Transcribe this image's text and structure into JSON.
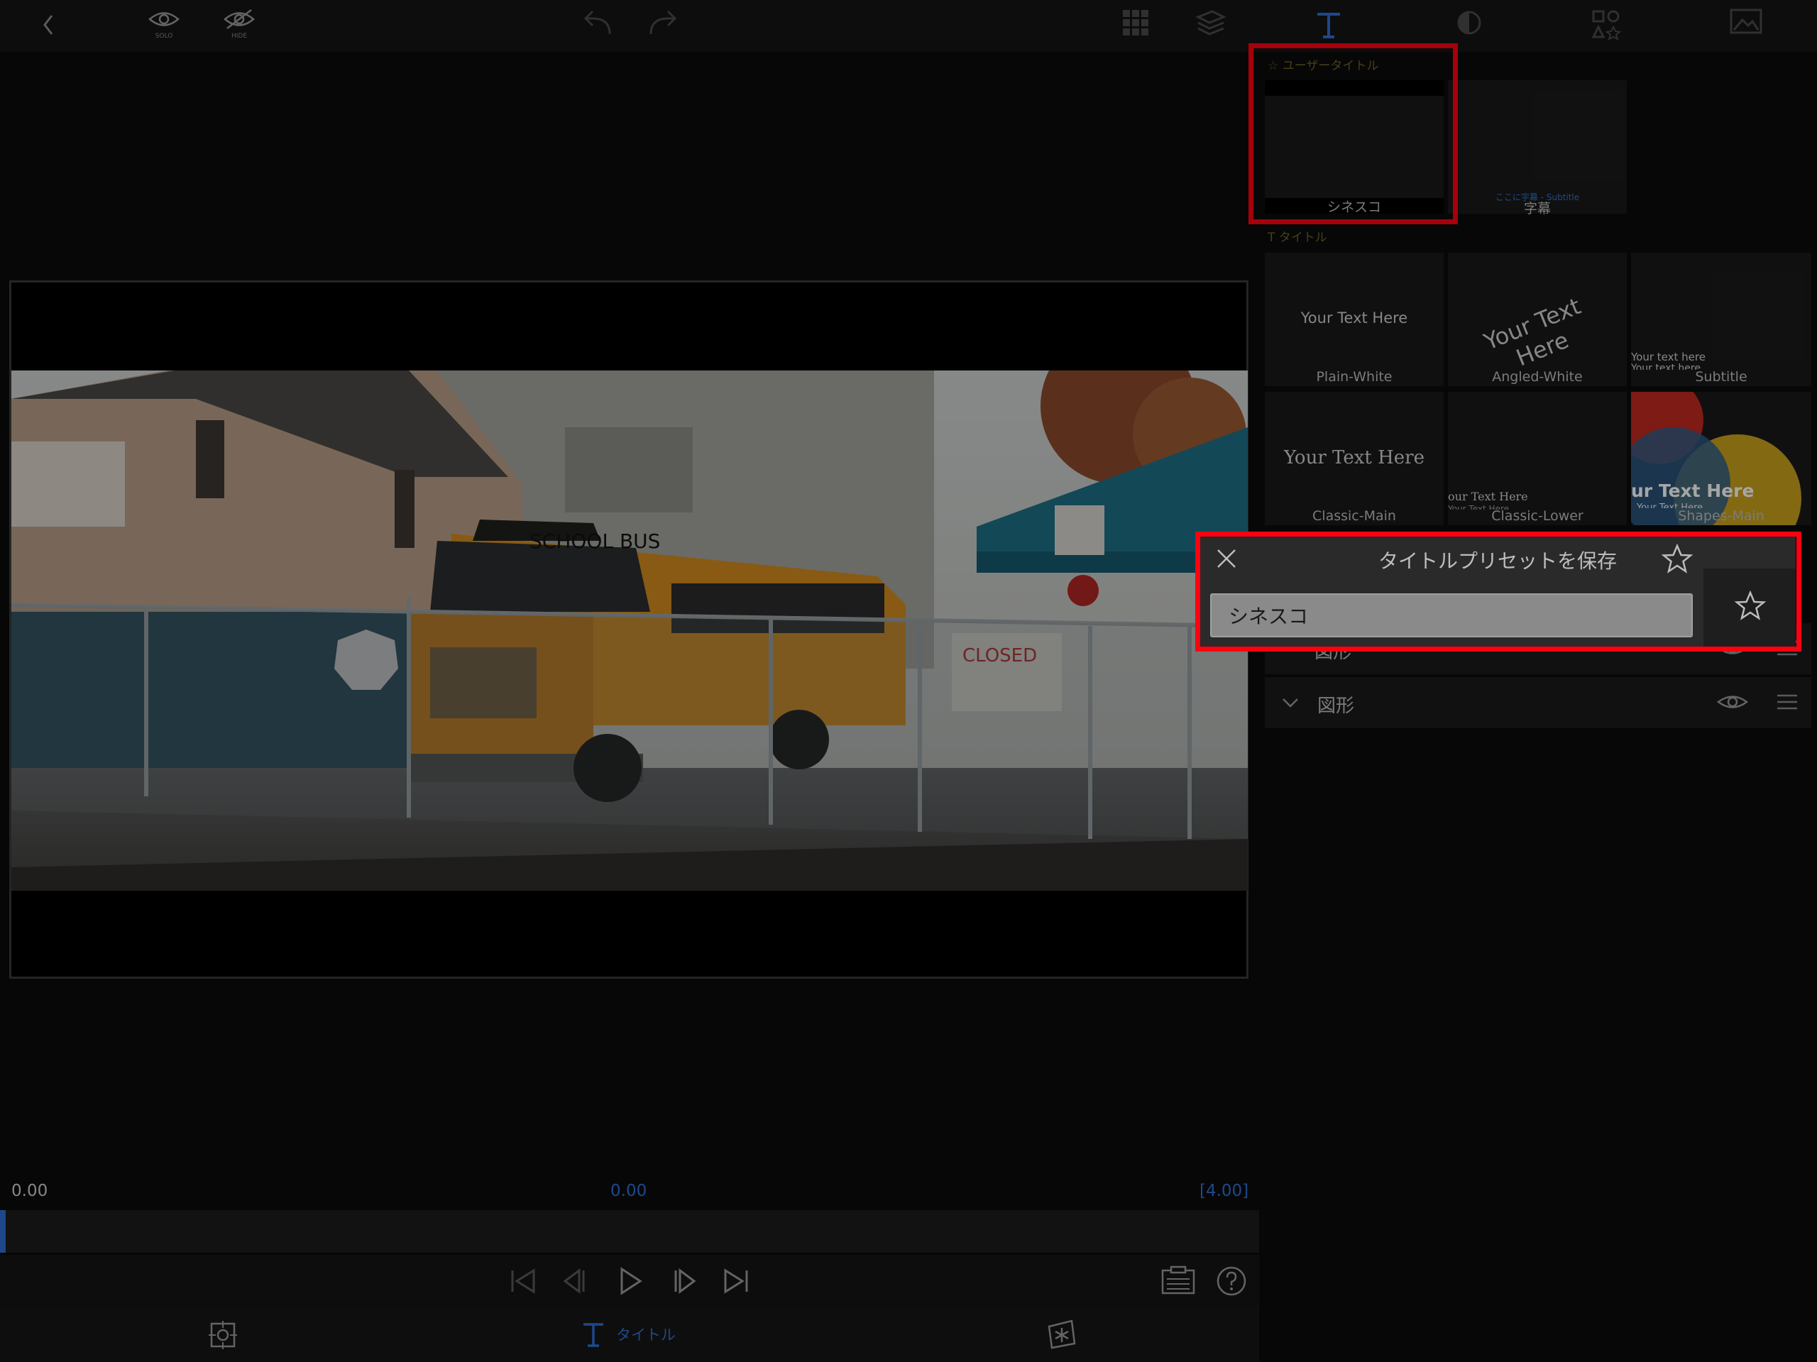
{
  "topbar": {
    "back_icon": "chevron-left-icon",
    "solo_label": "SOLO",
    "hide_label": "HIDE",
    "undo_icon": "undo-icon",
    "redo_icon": "redo-icon",
    "grid_icon": "grid-icon",
    "layers_icon": "layers-icon",
    "title_tool_icon": "title-T-icon",
    "color_icon": "color-circle-icon",
    "shapes_icon": "shapes-icon",
    "image_icon": "image-icon",
    "accent_color": "#2f6fd6"
  },
  "presets": {
    "user_section_label": "ユーザータイトル",
    "user_items": [
      {
        "label": "シネスコ"
      },
      {
        "label": "字幕",
        "preview_text": "ここに字幕 - Subtitle"
      }
    ],
    "title_section_label": "タイトル",
    "title_items": [
      {
        "label": "Plain-White",
        "preview_text": "Your Text Here"
      },
      {
        "label": "Angled-White",
        "preview_text": "Your Text Here"
      },
      {
        "label": "Subtitle",
        "preview_text": "Your text here",
        "preview_text2": "Your text here"
      },
      {
        "label": "Classic-Main",
        "preview_text": "Your Text Here"
      },
      {
        "label": "Classic-Lower",
        "preview_text": "our Text Here",
        "preview_text2": "Your Text Here"
      },
      {
        "label": "Shapes-Main",
        "preview_text": "ur Text Here",
        "preview_text2": "Your Text Here"
      }
    ]
  },
  "dialog": {
    "title": "タイトルプリセットを保存",
    "input_value": "シネスコ",
    "close_icon": "close-x-icon",
    "favorite_icon": "star-outline-icon"
  },
  "layers": [
    {
      "label": "図形",
      "icon": "eye-icon"
    },
    {
      "label": "図形",
      "icon": "eye-icon"
    }
  ],
  "timeline": {
    "start_time": "0.00",
    "current_time": "0.00",
    "duration": "[4.00]"
  },
  "bottombar": {
    "title_tab_label": "タイトル"
  }
}
